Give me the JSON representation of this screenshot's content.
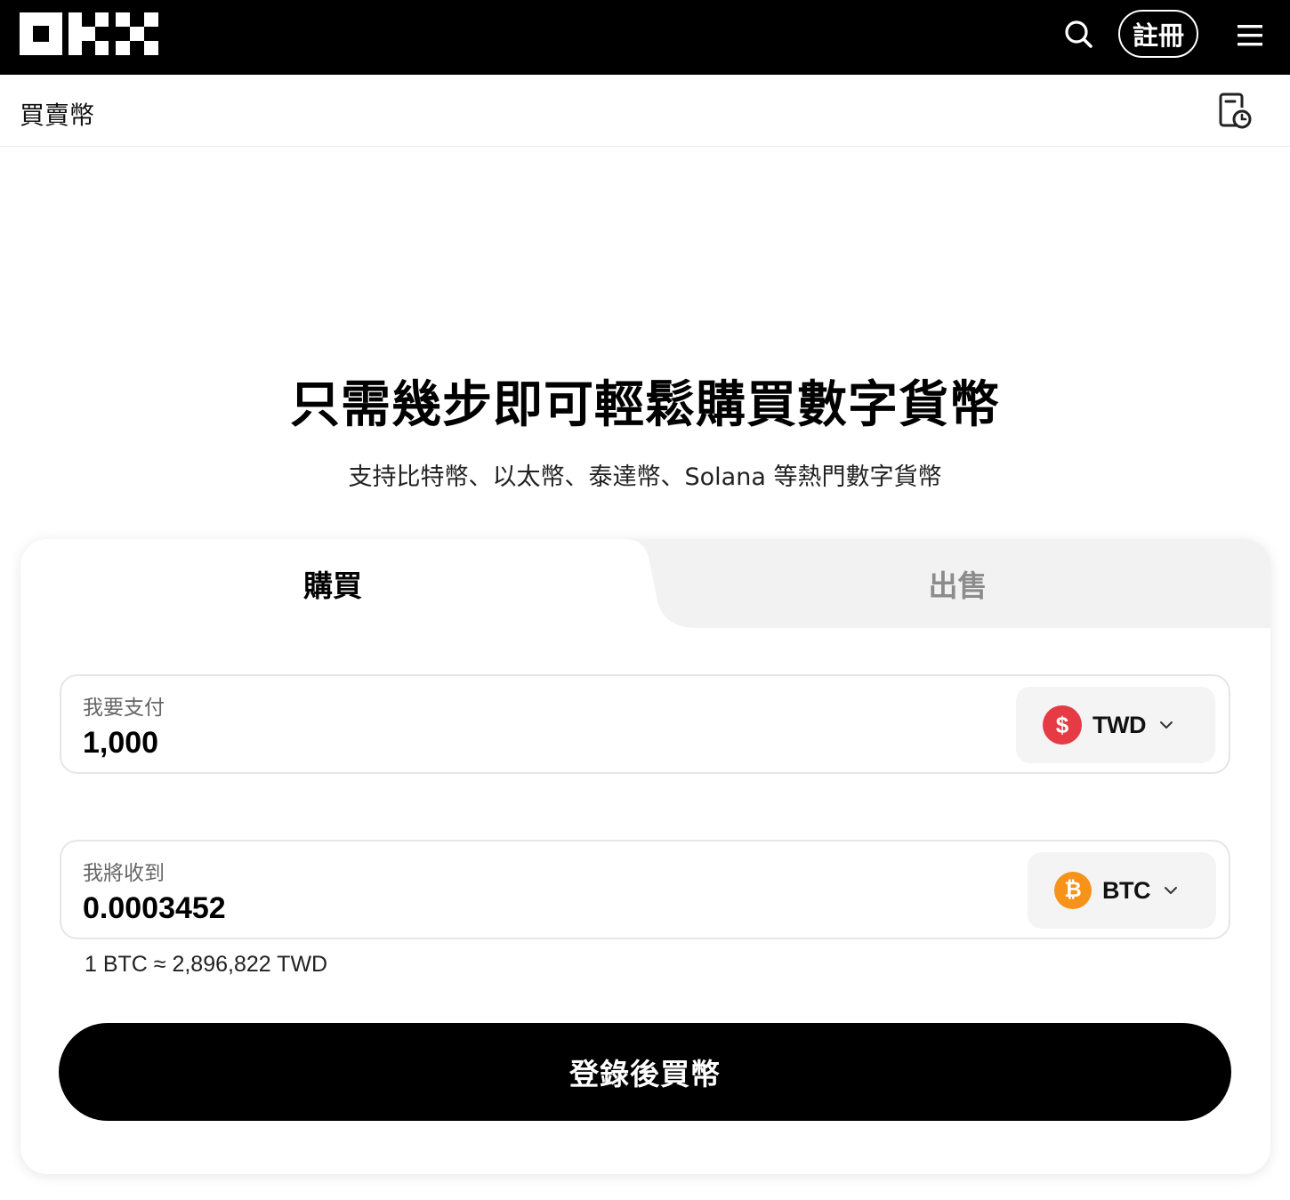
{
  "header": {
    "logo_icon": "okx-logo-icon",
    "search_icon": "search-icon",
    "register_label": "註冊",
    "menu_icon": "hamburger-menu-icon"
  },
  "subbar": {
    "title": "買賣幣",
    "history_icon": "order-history-icon"
  },
  "hero": {
    "title": "只需幾步即可輕鬆購買數字貨幣",
    "subtitle": "支持比特幣、以太幣、泰達幣、Solana 等熱門數字貨幣"
  },
  "trade": {
    "tabs": [
      {
        "label": "購買",
        "active": true
      },
      {
        "label": "出售",
        "active": false
      }
    ],
    "pay": {
      "label": "我要支付",
      "value": "1,000",
      "currency": "TWD",
      "currency_icon": "dollar-coin-icon",
      "currency_color": "#e63b44"
    },
    "receive": {
      "label": "我將收到",
      "value": "0.0003452",
      "currency": "BTC",
      "currency_icon": "bitcoin-icon",
      "currency_color": "#f7931a"
    },
    "rate": "1 BTC ≈ 2,896,822 TWD",
    "cta_label": "登錄後買幣"
  },
  "colors": {
    "header_bg": "#000000",
    "cta_bg": "#000000",
    "inactive_tab_text": "#8c8c8c"
  }
}
